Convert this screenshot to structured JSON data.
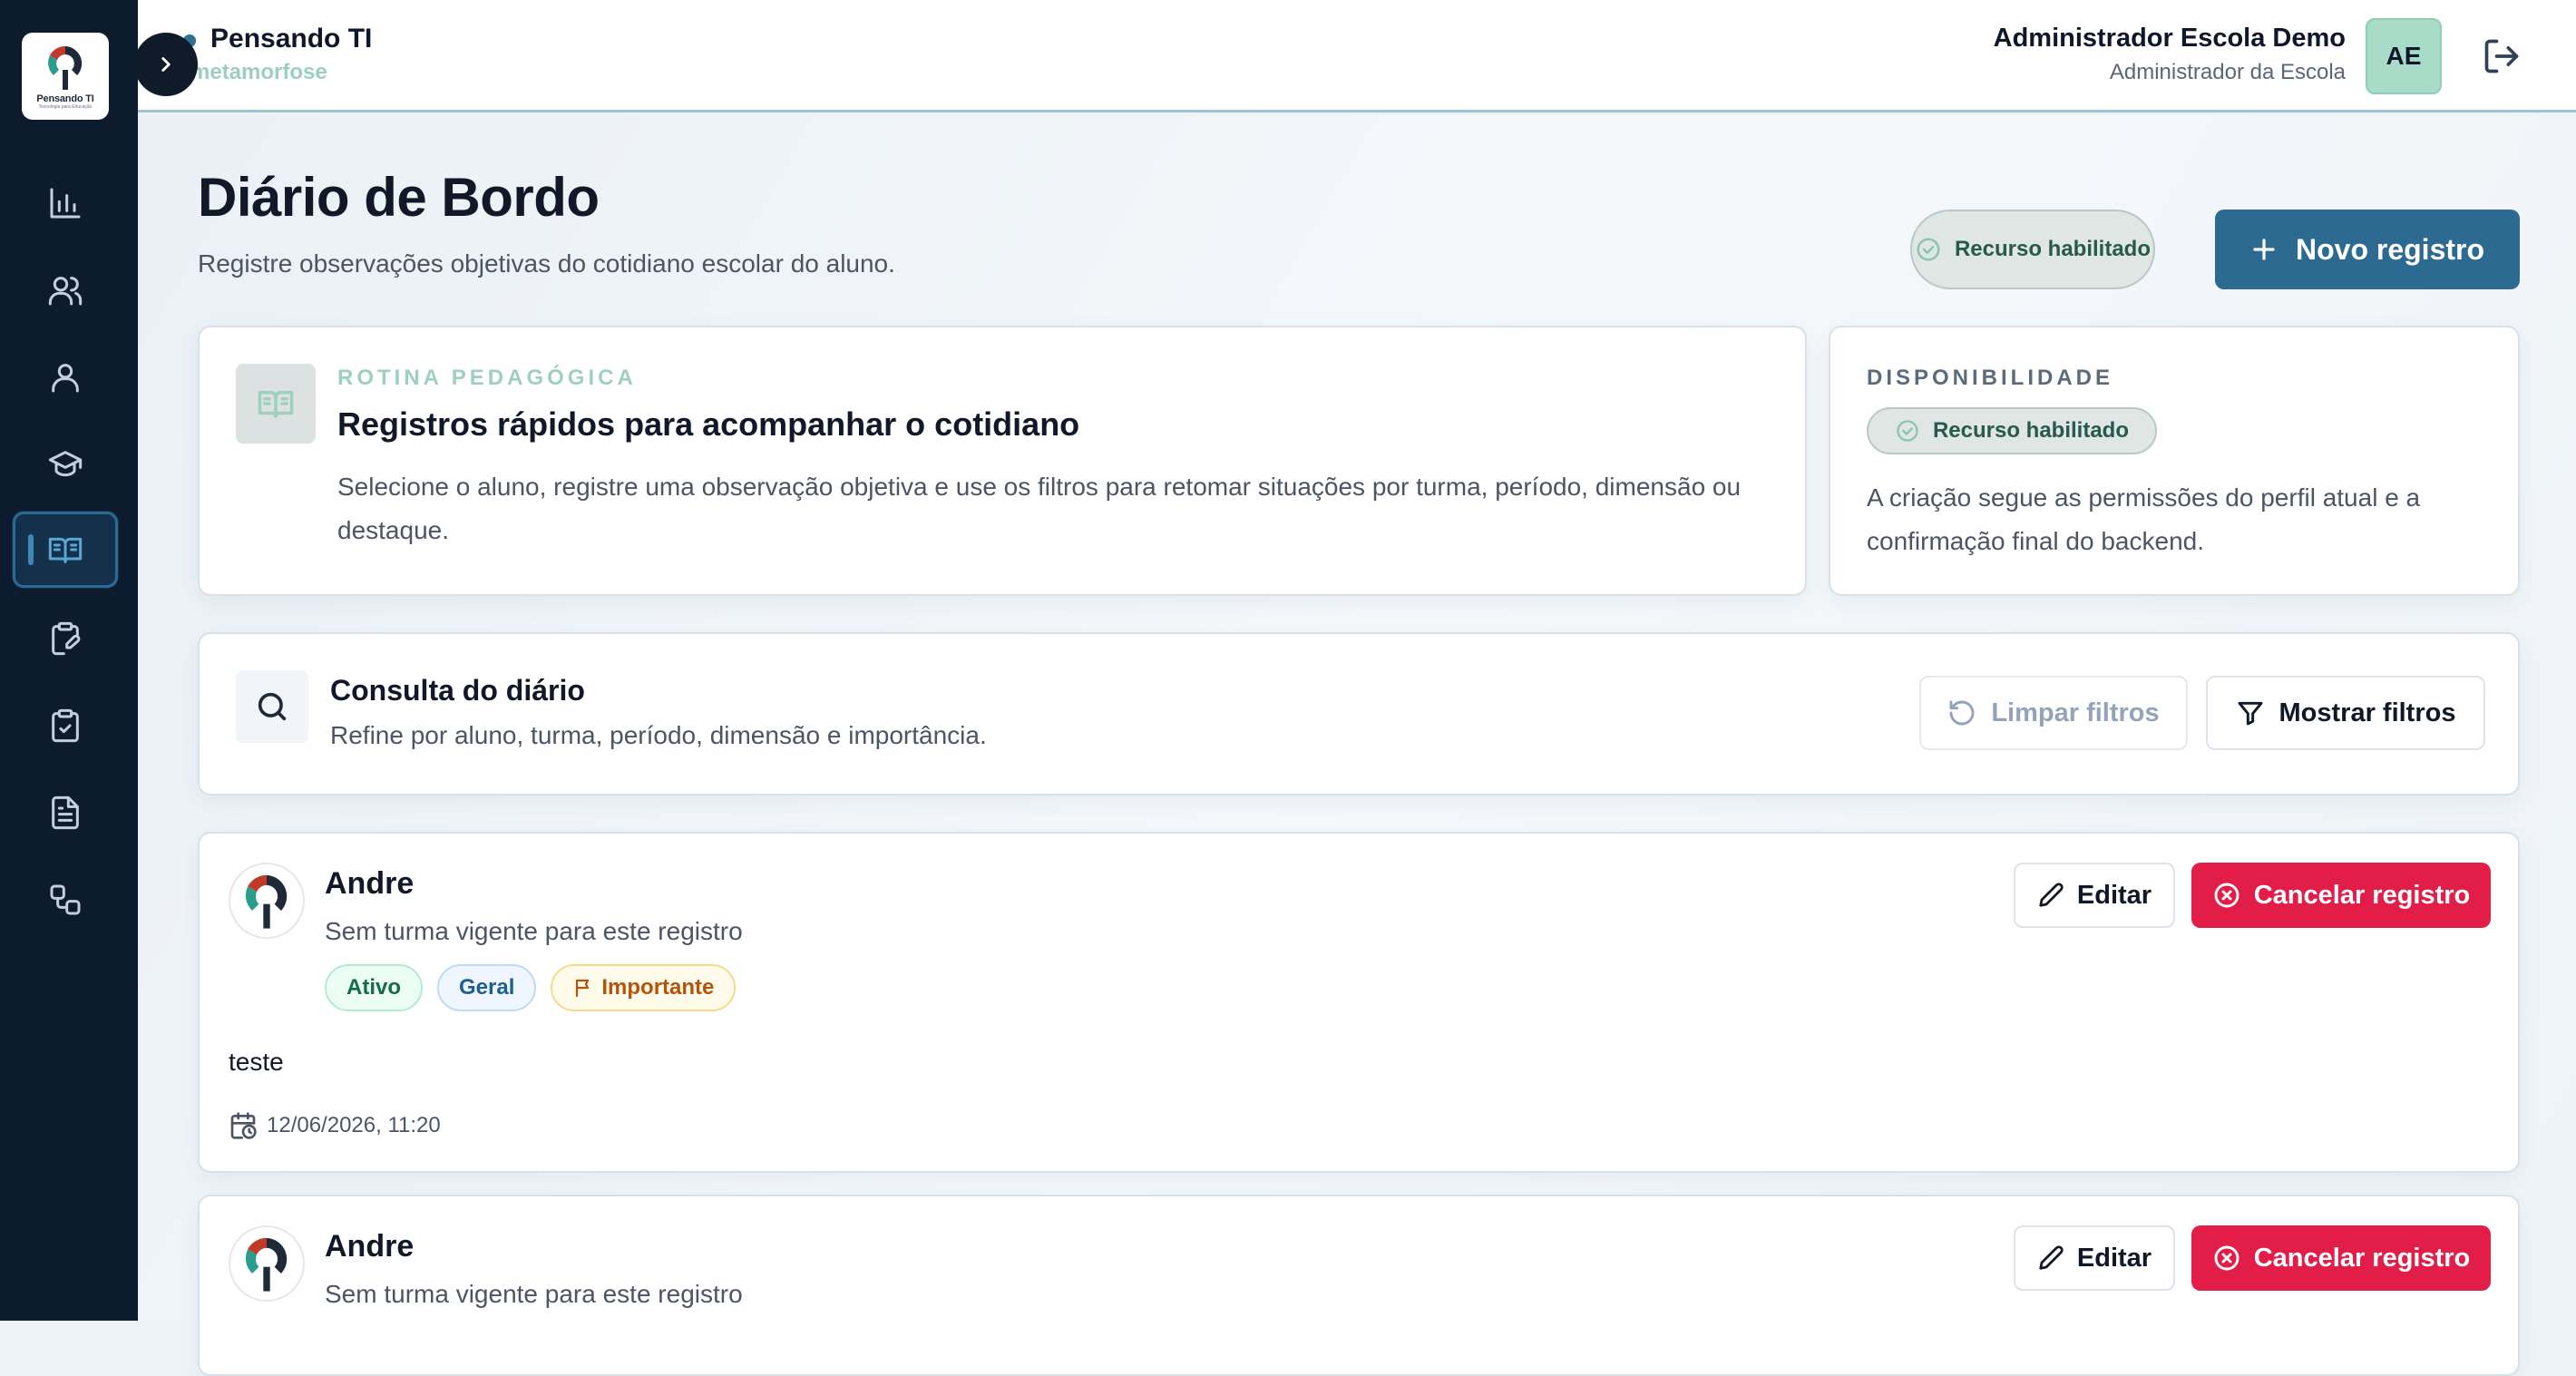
{
  "brand": {
    "logo_text": "Pensando TI",
    "logo_sub": "Tecnologia para Educação"
  },
  "header": {
    "org_name": "Pensando TI",
    "org_sub": "metamorfose",
    "user_name": "Administrador Escola Demo",
    "user_role": "Administrador da Escola",
    "avatar_initials": "AE"
  },
  "sidebar": {
    "items": [
      {
        "icon": "bar-chart-icon"
      },
      {
        "icon": "users-icon"
      },
      {
        "icon": "user-icon"
      },
      {
        "icon": "graduation-cap-icon"
      },
      {
        "icon": "book-open-icon",
        "active": true
      },
      {
        "icon": "clipboard-edit-icon"
      },
      {
        "icon": "clipboard-check-icon"
      },
      {
        "icon": "file-text-icon"
      },
      {
        "icon": "workflow-icon"
      }
    ]
  },
  "page": {
    "title": "Diário de Bordo",
    "subtitle": "Registre observações objetivas do cotidiano escolar do aluno.",
    "status_pill": "Recurso habilitado",
    "new_button": "Novo registro"
  },
  "routine": {
    "kicker": "ROTINA PEDAGÓGICA",
    "title": "Registros rápidos para acompanhar o cotidiano",
    "text": "Selecione o aluno, registre uma observação objetiva e use os filtros para retomar situações por turma, período, dimensão ou destaque."
  },
  "availability": {
    "kicker": "DISPONIBILIDADE",
    "pill": "Recurso habilitado",
    "text": "A criação segue as permissões do perfil atual e a confirmação final do backend."
  },
  "query": {
    "title": "Consulta do diário",
    "subtitle": "Refine por aluno, turma, período, dimensão e importância.",
    "clear_button": "Limpar filtros",
    "filter_button": "Mostrar filtros"
  },
  "entries": [
    {
      "name": "Andre",
      "class_info": "Sem turma vigente para este registro",
      "tags": [
        "Ativo",
        "Geral",
        "Importante"
      ],
      "body": "teste",
      "date": "12/06/2026, 11:20",
      "edit_label": "Editar",
      "cancel_label": "Cancelar registro"
    },
    {
      "name": "Andre",
      "class_info": "Sem turma vigente para este registro",
      "edit_label": "Editar",
      "cancel_label": "Cancelar registro"
    }
  ],
  "colors": {
    "sidebar_bg": "#0d1b2e",
    "primary": "#2d6a91",
    "danger": "#e11d48",
    "accent_mint": "#9fd0bd"
  }
}
